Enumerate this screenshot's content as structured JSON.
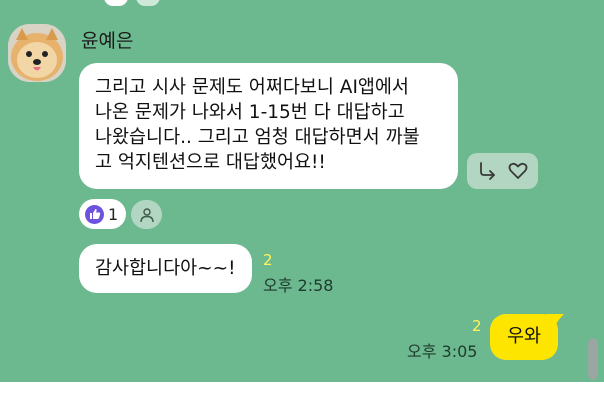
{
  "message": {
    "sender_name": "윤예은",
    "lines": [
      "그리고 시사 문제도 어쩌다보니 AI앱에서",
      "나온 문제가 나와서 1-15번 다 대답하고",
      "나왔습니다.. 그리고 엄청 대답하면서 까불",
      "고 억지텐션으로 대답했어요!!"
    ],
    "reactions": {
      "icon": "thumbs-up-icon",
      "count": "1"
    }
  },
  "message2": {
    "text": "감사합니다아~~!",
    "unread": "2",
    "time": "오후 2:58"
  },
  "my_message": {
    "text": "우와",
    "unread": "2",
    "time": "오후 3:05"
  },
  "colors": {
    "chat_background": "#6cb98f",
    "bubble": "#ffffff",
    "my_bubble": "#fee500",
    "unread_count": "#fff35a",
    "reaction_accent": "#6d52e0"
  }
}
